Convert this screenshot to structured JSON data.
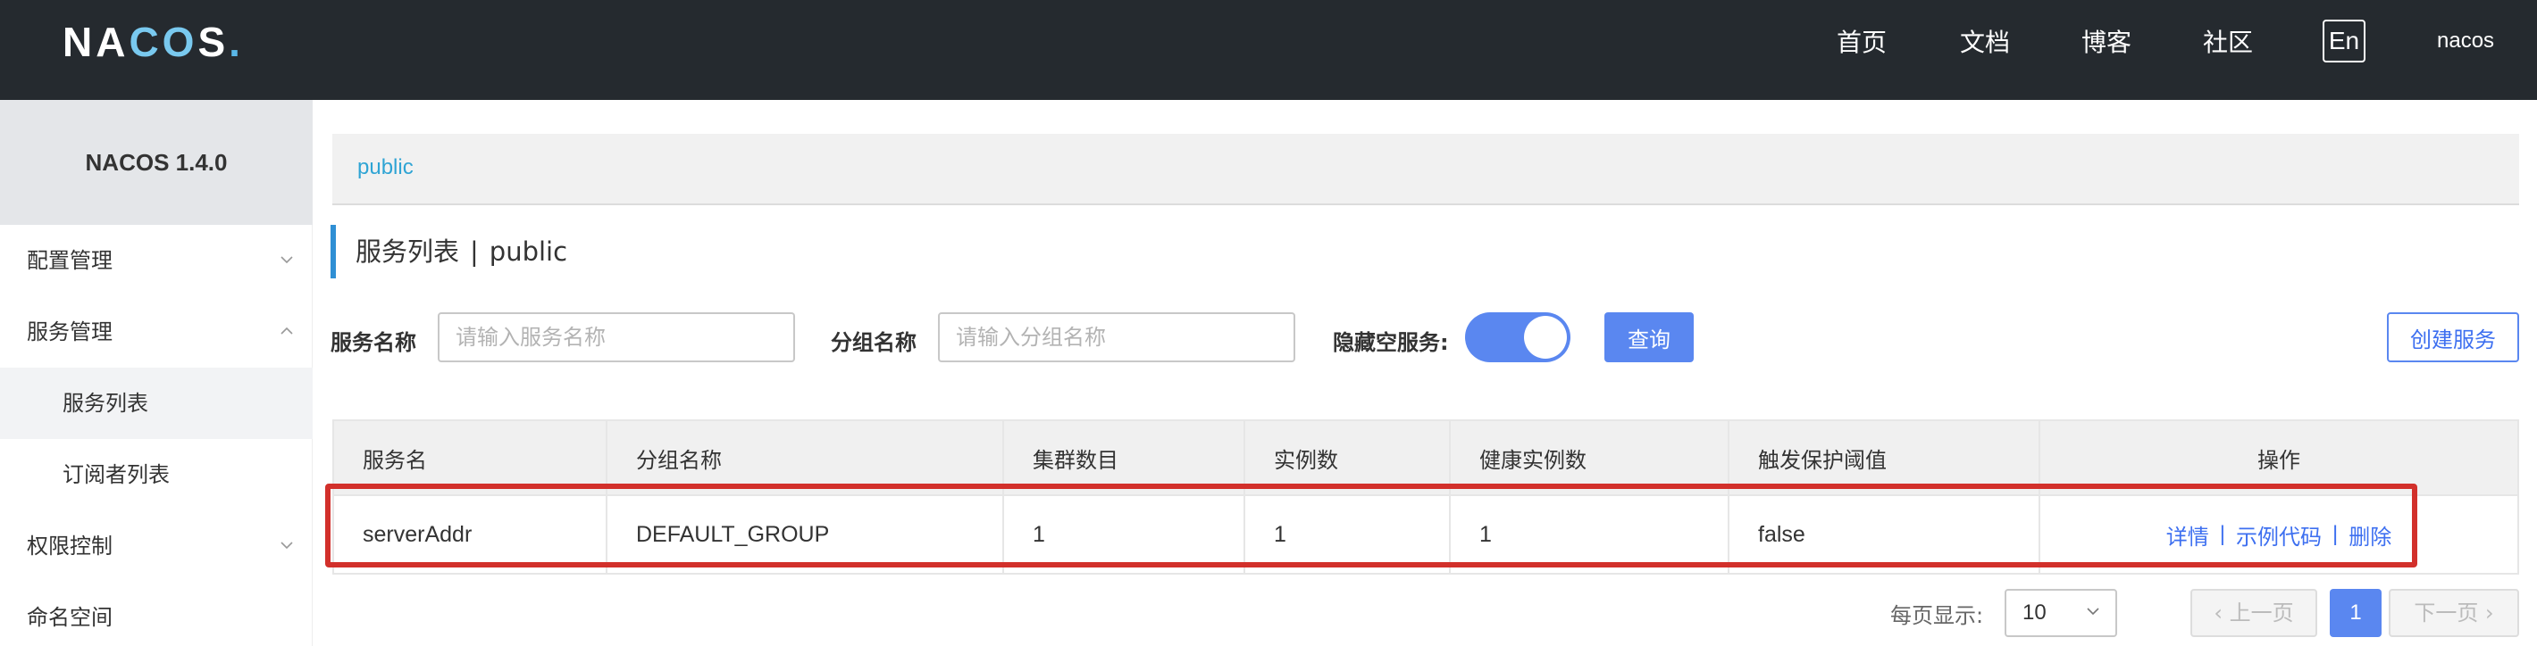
{
  "header": {
    "logo": {
      "left": "NA",
      "co": "CO",
      "right": "S",
      "dot": "."
    },
    "nav": [
      "首页",
      "文档",
      "博客",
      "社区"
    ],
    "lang_button": "En",
    "user": "nacos"
  },
  "sidebar": {
    "title": "NACOS 1.4.0",
    "items": [
      {
        "label": "配置管理",
        "type": "group",
        "expanded": false
      },
      {
        "label": "服务管理",
        "type": "group",
        "expanded": true
      },
      {
        "label": "服务列表",
        "type": "sub",
        "active": true
      },
      {
        "label": "订阅者列表",
        "type": "sub",
        "active": false
      },
      {
        "label": "权限控制",
        "type": "group",
        "expanded": false
      },
      {
        "label": "命名空间",
        "type": "item"
      }
    ]
  },
  "breadcrumb": {
    "namespace": "public"
  },
  "page_title": {
    "title": "服务列表",
    "separator": "|",
    "namespace": "public"
  },
  "filters": {
    "service_name_label": "服务名称",
    "service_name_placeholder": "请输入服务名称",
    "group_name_label": "分组名称",
    "group_name_placeholder": "请输入分组名称",
    "hide_empty_label": "隐藏空服务:",
    "hide_empty_on": true,
    "query_button": "查询",
    "create_button": "创建服务"
  },
  "table": {
    "columns": [
      "服务名",
      "分组名称",
      "集群数目",
      "实例数",
      "健康实例数",
      "触发保护阈值",
      "操作"
    ],
    "rows": [
      {
        "service": "serverAddr",
        "group": "DEFAULT_GROUP",
        "clusters": "1",
        "instances": "1",
        "healthy": "1",
        "threshold": "false",
        "actions": [
          "详情",
          "示例代码",
          "删除"
        ],
        "action_sep": "|"
      }
    ]
  },
  "pagination": {
    "page_size_label": "每页显示:",
    "page_size": "10",
    "prev": "上一页",
    "current": "1",
    "next": "下一页"
  },
  "colors": {
    "header_bg": "#252a2f",
    "primary": "#5a87f0",
    "link": "#3d6ff0",
    "highlight_border": "#d2302b",
    "crumb": "#2fa4d4"
  }
}
